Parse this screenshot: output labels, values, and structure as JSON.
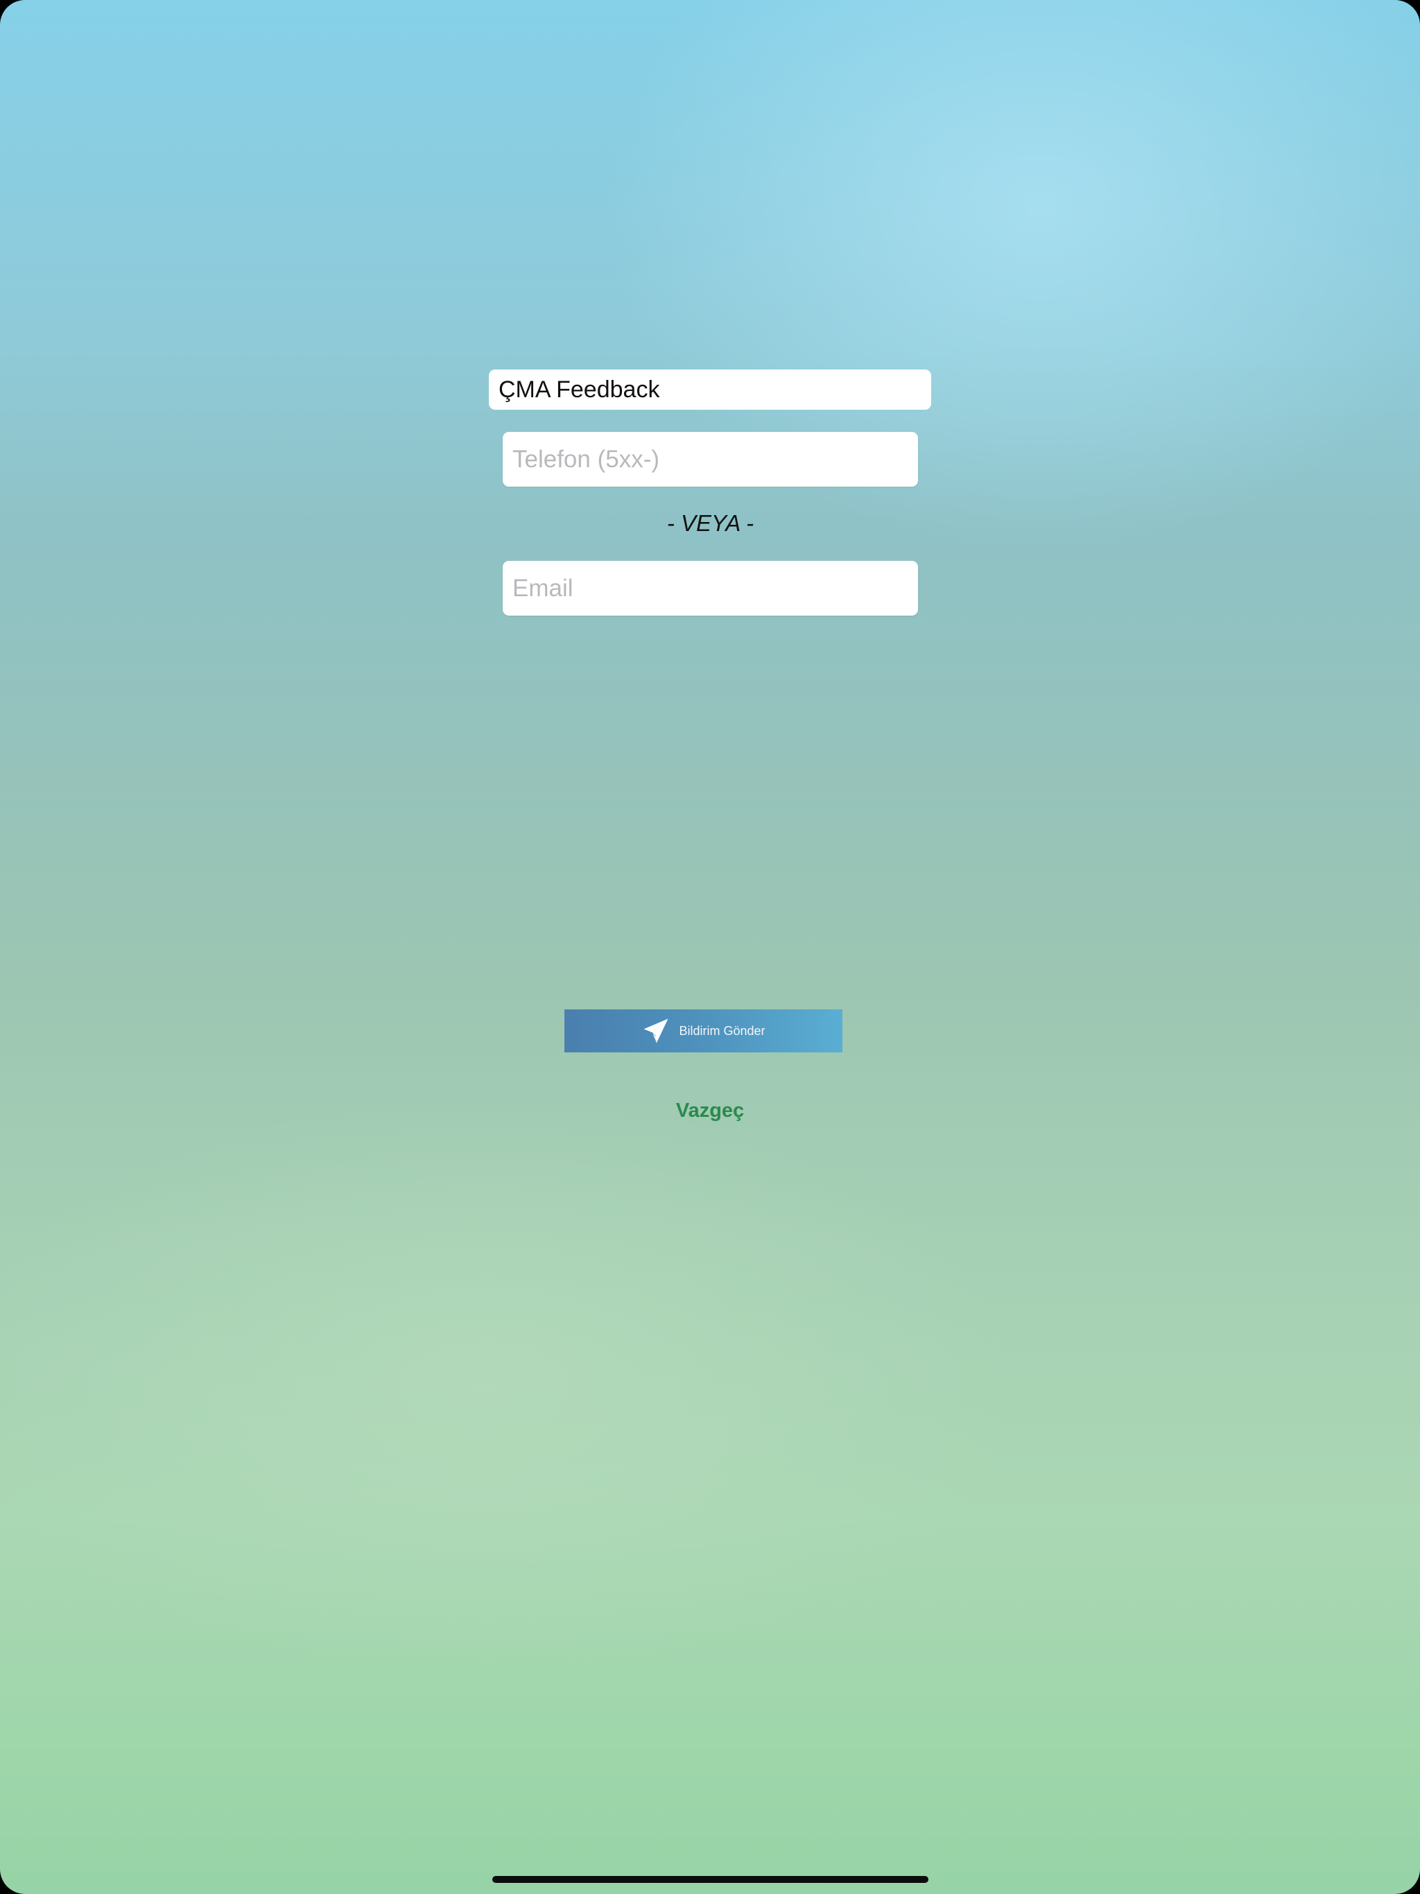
{
  "form": {
    "title": "ÇMA  Feedback",
    "phone": {
      "value": "",
      "placeholder": "Telefon (5xx-)"
    },
    "or_label": "- VEYA -",
    "email": {
      "value": "",
      "placeholder": "Email"
    },
    "send_button_label": "Bildirim Gönder",
    "cancel_label": "Vazgeç"
  },
  "icons": {
    "send": "paper-plane-icon"
  },
  "colors": {
    "button_gradient_start": "#4a7fae",
    "button_gradient_end": "#5aaed3",
    "cancel_text": "#2a8a4e",
    "background_top": "#86d0e8",
    "background_bottom": "#96d3a6"
  }
}
